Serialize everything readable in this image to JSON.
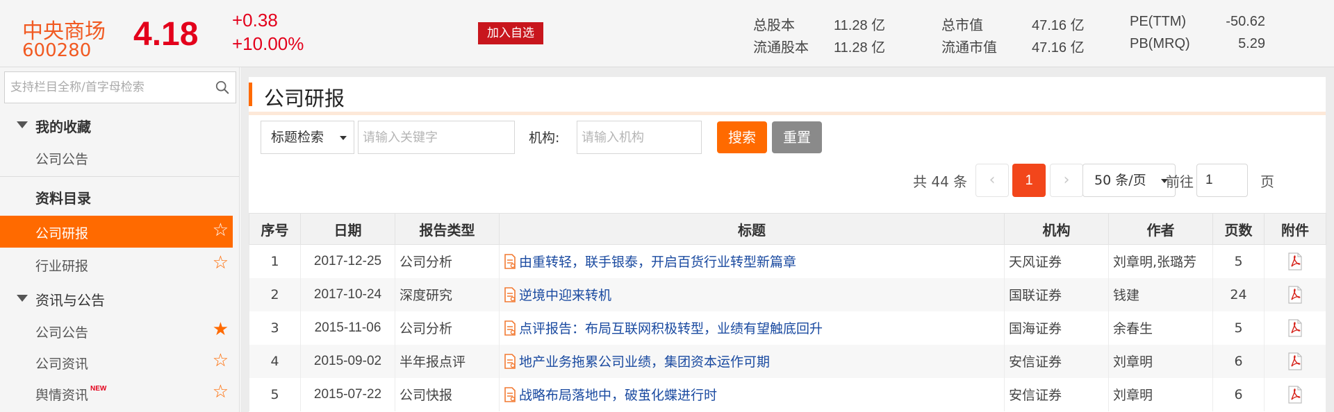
{
  "header": {
    "stock_name": "中央商场",
    "stock_code": "600280",
    "price": "4.18",
    "change": "+0.38",
    "change_pct": "+10.00%",
    "add_watchlist": "加入自选",
    "metrics": [
      {
        "label": "总股本",
        "value": "11.28 亿"
      },
      {
        "label": "流通股本",
        "value": "11.28 亿"
      },
      {
        "label": "总市值",
        "value": "47.16 亿"
      },
      {
        "label": "流通市值",
        "value": "47.16 亿"
      },
      {
        "label": "PE(TTM)",
        "value": "-50.62"
      },
      {
        "label": "PB(MRQ)",
        "value": "5.29"
      }
    ],
    "accent_color": "#f15a22",
    "up_color": "#e3001b"
  },
  "sidebar": {
    "search_placeholder": "支持栏目全称/首字母检索",
    "favorites_title": "我的收藏",
    "favorites_items": [
      {
        "label": "公司公告"
      }
    ],
    "catalog_title": "资料目录",
    "catalog_items": [
      {
        "label": "公司研报",
        "active": true,
        "star": "☆"
      },
      {
        "label": "行业研报",
        "active": false,
        "star": "☆"
      }
    ],
    "news_title": "资讯与公告",
    "news_items": [
      {
        "label": "公司公告",
        "star": "★"
      },
      {
        "label": "公司资讯",
        "star": "☆"
      },
      {
        "label": "舆情资讯",
        "star": "☆",
        "badge": "NEW"
      }
    ]
  },
  "main": {
    "title": "公司研报",
    "filter": {
      "search_type": "标题检索",
      "keyword_placeholder": "请输入关键字",
      "institution_label": "机构:",
      "institution_placeholder": "请输入机构",
      "search_button": "搜索",
      "reset_button": "重置"
    },
    "pagination": {
      "total_text": "共 44 条",
      "prev": "‹",
      "current_page": "1",
      "next": "›",
      "page_size": "50 条/页",
      "goto_prefix": "前往",
      "goto_value": "1",
      "goto_suffix": "页"
    },
    "table": {
      "columns": [
        "序号",
        "日期",
        "报告类型",
        "标题",
        "机构",
        "作者",
        "页数",
        "附件"
      ],
      "rows": [
        {
          "no": "1",
          "date": "2017-12-25",
          "type": "公司分析",
          "title": "由重转轻，联手银泰，开启百货行业转型新篇章",
          "institution": "天风证券",
          "author": "刘章明,张璐芳",
          "pages": "5"
        },
        {
          "no": "2",
          "date": "2017-10-24",
          "type": "深度研究",
          "title": "逆境中迎来转机",
          "institution": "国联证券",
          "author": "钱建",
          "pages": "24"
        },
        {
          "no": "3",
          "date": "2015-11-06",
          "type": "公司分析",
          "title": "点评报告：布局互联网积极转型，业绩有望触底回升",
          "institution": "国海证券",
          "author": "余春生",
          "pages": "5"
        },
        {
          "no": "4",
          "date": "2015-09-02",
          "type": "半年报点评",
          "title": "地产业务拖累公司业绩，集团资本运作可期",
          "institution": "安信证券",
          "author": "刘章明",
          "pages": "6"
        },
        {
          "no": "5",
          "date": "2015-07-22",
          "type": "公司快报",
          "title": "战略布局落地中，破茧化蝶进行时",
          "institution": "安信证券",
          "author": "刘章明",
          "pages": "6"
        }
      ]
    }
  }
}
